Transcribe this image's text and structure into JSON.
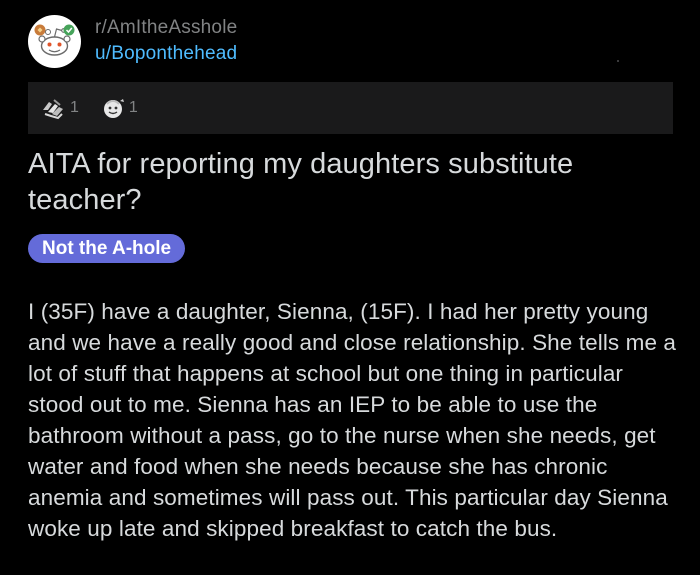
{
  "header": {
    "subreddit": "r/AmItheAsshole",
    "username": "u/Boponthehead",
    "avatar_icon": "reddit-snoo-icon"
  },
  "awards": [
    {
      "icon": "helpful-hands-icon",
      "count": "1"
    },
    {
      "icon": "wholesome-award-icon",
      "count": "1"
    }
  ],
  "post": {
    "title": "AITA for reporting my daughters substitute teacher?",
    "flair": "Not the A-hole",
    "flair_color": "#646bd9",
    "body": "I (35F) have a daughter, Sienna, (15F). I had her pretty young and we have a really good and close relationship. She tells me a lot of stuff that happens at school but one thing in particular stood out to me. Sienna has an IEP to be able to use the bathroom without a pass, go to the nurse when she needs, get water and food when she needs because she has chronic anemia and sometimes will pass out. This particular day Sienna woke up late and skipped breakfast to catch the bus."
  },
  "colors": {
    "background": "#000000",
    "text": "#d7dadc",
    "muted": "#818384",
    "link": "#4fbcff",
    "bar": "#1a1a1b"
  }
}
